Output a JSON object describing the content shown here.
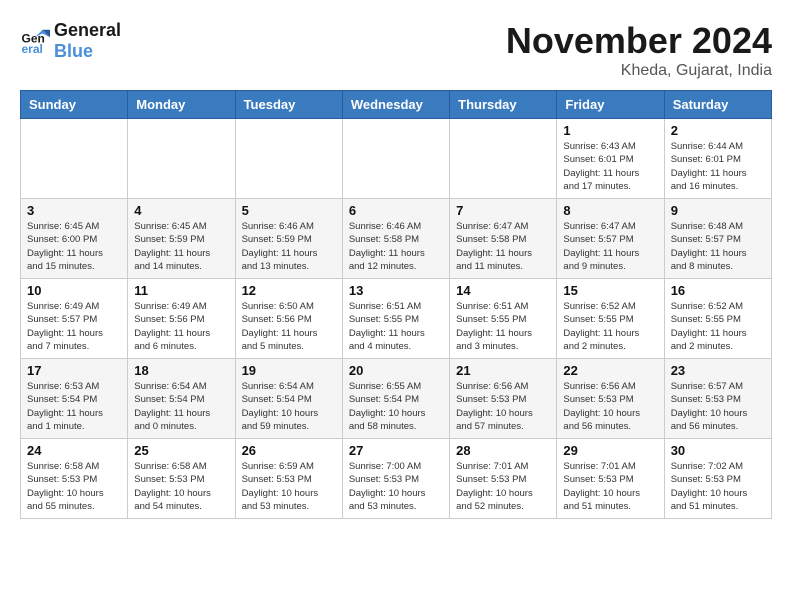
{
  "header": {
    "logo_line1": "General",
    "logo_line2": "Blue",
    "month_title": "November 2024",
    "location": "Kheda, Gujarat, India"
  },
  "weekdays": [
    "Sunday",
    "Monday",
    "Tuesday",
    "Wednesday",
    "Thursday",
    "Friday",
    "Saturday"
  ],
  "weeks": [
    [
      {
        "day": "",
        "info": ""
      },
      {
        "day": "",
        "info": ""
      },
      {
        "day": "",
        "info": ""
      },
      {
        "day": "",
        "info": ""
      },
      {
        "day": "",
        "info": ""
      },
      {
        "day": "1",
        "info": "Sunrise: 6:43 AM\nSunset: 6:01 PM\nDaylight: 11 hours\nand 17 minutes."
      },
      {
        "day": "2",
        "info": "Sunrise: 6:44 AM\nSunset: 6:01 PM\nDaylight: 11 hours\nand 16 minutes."
      }
    ],
    [
      {
        "day": "3",
        "info": "Sunrise: 6:45 AM\nSunset: 6:00 PM\nDaylight: 11 hours\nand 15 minutes."
      },
      {
        "day": "4",
        "info": "Sunrise: 6:45 AM\nSunset: 5:59 PM\nDaylight: 11 hours\nand 14 minutes."
      },
      {
        "day": "5",
        "info": "Sunrise: 6:46 AM\nSunset: 5:59 PM\nDaylight: 11 hours\nand 13 minutes."
      },
      {
        "day": "6",
        "info": "Sunrise: 6:46 AM\nSunset: 5:58 PM\nDaylight: 11 hours\nand 12 minutes."
      },
      {
        "day": "7",
        "info": "Sunrise: 6:47 AM\nSunset: 5:58 PM\nDaylight: 11 hours\nand 11 minutes."
      },
      {
        "day": "8",
        "info": "Sunrise: 6:47 AM\nSunset: 5:57 PM\nDaylight: 11 hours\nand 9 minutes."
      },
      {
        "day": "9",
        "info": "Sunrise: 6:48 AM\nSunset: 5:57 PM\nDaylight: 11 hours\nand 8 minutes."
      }
    ],
    [
      {
        "day": "10",
        "info": "Sunrise: 6:49 AM\nSunset: 5:57 PM\nDaylight: 11 hours\nand 7 minutes."
      },
      {
        "day": "11",
        "info": "Sunrise: 6:49 AM\nSunset: 5:56 PM\nDaylight: 11 hours\nand 6 minutes."
      },
      {
        "day": "12",
        "info": "Sunrise: 6:50 AM\nSunset: 5:56 PM\nDaylight: 11 hours\nand 5 minutes."
      },
      {
        "day": "13",
        "info": "Sunrise: 6:51 AM\nSunset: 5:55 PM\nDaylight: 11 hours\nand 4 minutes."
      },
      {
        "day": "14",
        "info": "Sunrise: 6:51 AM\nSunset: 5:55 PM\nDaylight: 11 hours\nand 3 minutes."
      },
      {
        "day": "15",
        "info": "Sunrise: 6:52 AM\nSunset: 5:55 PM\nDaylight: 11 hours\nand 2 minutes."
      },
      {
        "day": "16",
        "info": "Sunrise: 6:52 AM\nSunset: 5:55 PM\nDaylight: 11 hours\nand 2 minutes."
      }
    ],
    [
      {
        "day": "17",
        "info": "Sunrise: 6:53 AM\nSunset: 5:54 PM\nDaylight: 11 hours\nand 1 minute."
      },
      {
        "day": "18",
        "info": "Sunrise: 6:54 AM\nSunset: 5:54 PM\nDaylight: 11 hours\nand 0 minutes."
      },
      {
        "day": "19",
        "info": "Sunrise: 6:54 AM\nSunset: 5:54 PM\nDaylight: 10 hours\nand 59 minutes."
      },
      {
        "day": "20",
        "info": "Sunrise: 6:55 AM\nSunset: 5:54 PM\nDaylight: 10 hours\nand 58 minutes."
      },
      {
        "day": "21",
        "info": "Sunrise: 6:56 AM\nSunset: 5:53 PM\nDaylight: 10 hours\nand 57 minutes."
      },
      {
        "day": "22",
        "info": "Sunrise: 6:56 AM\nSunset: 5:53 PM\nDaylight: 10 hours\nand 56 minutes."
      },
      {
        "day": "23",
        "info": "Sunrise: 6:57 AM\nSunset: 5:53 PM\nDaylight: 10 hours\nand 56 minutes."
      }
    ],
    [
      {
        "day": "24",
        "info": "Sunrise: 6:58 AM\nSunset: 5:53 PM\nDaylight: 10 hours\nand 55 minutes."
      },
      {
        "day": "25",
        "info": "Sunrise: 6:58 AM\nSunset: 5:53 PM\nDaylight: 10 hours\nand 54 minutes."
      },
      {
        "day": "26",
        "info": "Sunrise: 6:59 AM\nSunset: 5:53 PM\nDaylight: 10 hours\nand 53 minutes."
      },
      {
        "day": "27",
        "info": "Sunrise: 7:00 AM\nSunset: 5:53 PM\nDaylight: 10 hours\nand 53 minutes."
      },
      {
        "day": "28",
        "info": "Sunrise: 7:01 AM\nSunset: 5:53 PM\nDaylight: 10 hours\nand 52 minutes."
      },
      {
        "day": "29",
        "info": "Sunrise: 7:01 AM\nSunset: 5:53 PM\nDaylight: 10 hours\nand 51 minutes."
      },
      {
        "day": "30",
        "info": "Sunrise: 7:02 AM\nSunset: 5:53 PM\nDaylight: 10 hours\nand 51 minutes."
      }
    ]
  ]
}
